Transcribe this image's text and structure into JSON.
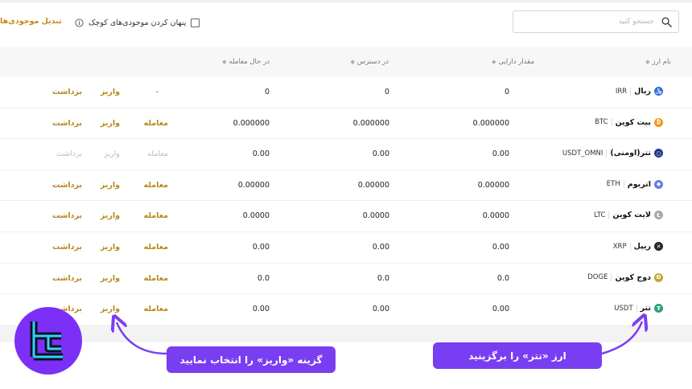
{
  "toolbar": {
    "search_placeholder": "جستجو کنید",
    "hide_small_label": "پنهان کردن موجودی‌های کوچک",
    "convert_label": "تبدیل موجودی‌ها"
  },
  "table": {
    "headers": {
      "currency": "نام ارز",
      "balance": "مقدار دارایی",
      "available": "در دسترس",
      "in_trade": "در حال معامله"
    },
    "rows": [
      {
        "name": "ریال",
        "code": "IRR",
        "balance": "0",
        "available": "0",
        "in_trade": "0",
        "trade": "-",
        "deposit": "واریز",
        "withdraw": "برداشت",
        "color": "#2f6bd8",
        "glyph": "﷼",
        "active": true
      },
      {
        "name": "بیت کوین",
        "code": "BTC",
        "balance": "0.000000",
        "available": "0.000000",
        "in_trade": "0.000000",
        "trade": "معامله",
        "deposit": "واریز",
        "withdraw": "برداشت",
        "color": "#f7931a",
        "glyph": "₿",
        "active": true
      },
      {
        "name": "تتر(اومنی)",
        "code": "USDT_OMNI",
        "balance": "0.00",
        "available": "0.00",
        "in_trade": "0.00",
        "trade": "معامله",
        "deposit": "واریز",
        "withdraw": "برداشت",
        "color": "#1d3b8a",
        "glyph": "○",
        "active": false
      },
      {
        "name": "اتریوم",
        "code": "ETH",
        "balance": "0.00000",
        "available": "0.00000",
        "in_trade": "0.00000",
        "trade": "معامله",
        "deposit": "واریز",
        "withdraw": "برداشت",
        "color": "#627eea",
        "glyph": "◆",
        "active": true
      },
      {
        "name": "لایت کوین",
        "code": "LTC",
        "balance": "0.0000",
        "available": "0.0000",
        "in_trade": "0.0000",
        "trade": "معامله",
        "deposit": "واریز",
        "withdraw": "برداشت",
        "color": "#a6a9aa",
        "glyph": "Ł",
        "active": true
      },
      {
        "name": "ریپل",
        "code": "XRP",
        "balance": "0.00",
        "available": "0.00",
        "in_trade": "0.00",
        "trade": "معامله",
        "deposit": "واریز",
        "withdraw": "برداشت",
        "color": "#23292f",
        "glyph": "✕",
        "active": true
      },
      {
        "name": "دوج کوین",
        "code": "DOGE",
        "balance": "0.0",
        "available": "0.0",
        "in_trade": "0.0",
        "trade": "معامله",
        "deposit": "واریز",
        "withdraw": "برداشت",
        "color": "#c2a633",
        "glyph": "Ð",
        "active": true
      },
      {
        "name": "تتر",
        "code": "USDT",
        "balance": "0.00",
        "available": "0.00",
        "in_trade": "0.00",
        "trade": "معامله",
        "deposit": "واریز",
        "withdraw": "برداشت",
        "color": "#26a17b",
        "glyph": "₮",
        "active": true
      }
    ]
  },
  "annotations": {
    "select_tether": "ارز «تتر» را برگزینید",
    "select_deposit": "گزینه «واریز» را انتخاب نمایید"
  },
  "colors": {
    "accent": "#b8861a",
    "callout": "#7a3ef2",
    "logo": "#7b2ff7"
  }
}
